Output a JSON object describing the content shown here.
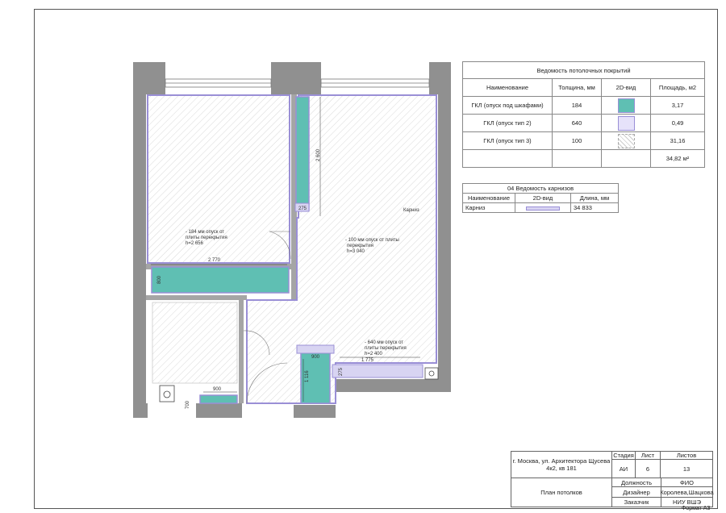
{
  "plan": {
    "dims": {
      "d2770": "2 770",
      "d800": "800",
      "d2600": "2 600",
      "d275a": "275",
      "d900": "900",
      "d1116": "1 116",
      "d275b": "275",
      "d1775": "1 775",
      "d900b": "900",
      "d700": "700"
    },
    "notes": {
      "n184_1": "- 184 мм опуск от",
      "n184_2": "плиты перекрытия",
      "n184_3": "h=2 656",
      "n100_1": "- 100 мм опуск от плиты",
      "n100_2": "перекрытия",
      "n100_3": "h=3 040",
      "n640_1": "- 640 мм опуск от",
      "n640_2": "плиты перекрытия",
      "n640_3": "h=2 400",
      "karniz": "Карниз"
    },
    "colors": {
      "teal": "#5fbfb3",
      "lilac": "#d8d4f2",
      "outline": "#9a8fd6",
      "wall": "#909090"
    }
  },
  "ceiling_table": {
    "title": "Ведомость потолочных покрытий",
    "headers": [
      "Наименование",
      "Толщина, мм",
      "2D-вид",
      "Площадь, м2"
    ],
    "rows": [
      {
        "name": "ГКЛ (опуск под шкафами)",
        "thickness": "184",
        "swatch": "teal",
        "area": "3,17"
      },
      {
        "name": "ГКЛ (опуск тип 2)",
        "thickness": "640",
        "swatch": "lilac",
        "area": "0,49"
      },
      {
        "name": "ГКЛ (опуск тип 3)",
        "thickness": "100",
        "swatch": "hatch",
        "area": "31,16"
      }
    ],
    "total": "34,82 м²"
  },
  "cornice_table": {
    "title": "04  Ведомость карнизов",
    "headers": [
      "Наименование",
      "2D-вид",
      "Длина, мм"
    ],
    "row": {
      "name": "Карниз",
      "length": "34 833"
    }
  },
  "title_block": {
    "address": "г. Москва, ул. Архитектора Щусева 4к2, кв 181",
    "sheet_title": "План потолков",
    "stage_label": "Стадия",
    "sheet_label": "Лист",
    "sheets_label": "Листов",
    "stage": "АИ",
    "sheet": "6",
    "sheets": "13",
    "position_label": "Должность",
    "fio_label": "ФИО",
    "designer_label": "Дизайнер",
    "designer": "Королева,Шацкова",
    "customer_label": "Заказчик",
    "customer": "НИУ ВШЭ"
  },
  "format": "Формат А3"
}
